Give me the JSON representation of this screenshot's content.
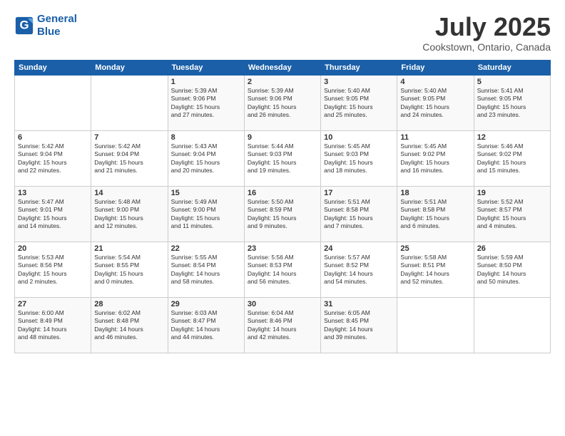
{
  "logo": {
    "line1": "General",
    "line2": "Blue"
  },
  "title": "July 2025",
  "location": "Cookstown, Ontario, Canada",
  "weekdays": [
    "Sunday",
    "Monday",
    "Tuesday",
    "Wednesday",
    "Thursday",
    "Friday",
    "Saturday"
  ],
  "weeks": [
    [
      {
        "day": "",
        "content": ""
      },
      {
        "day": "",
        "content": ""
      },
      {
        "day": "1",
        "content": "Sunrise: 5:39 AM\nSunset: 9:06 PM\nDaylight: 15 hours\nand 27 minutes."
      },
      {
        "day": "2",
        "content": "Sunrise: 5:39 AM\nSunset: 9:06 PM\nDaylight: 15 hours\nand 26 minutes."
      },
      {
        "day": "3",
        "content": "Sunrise: 5:40 AM\nSunset: 9:05 PM\nDaylight: 15 hours\nand 25 minutes."
      },
      {
        "day": "4",
        "content": "Sunrise: 5:40 AM\nSunset: 9:05 PM\nDaylight: 15 hours\nand 24 minutes."
      },
      {
        "day": "5",
        "content": "Sunrise: 5:41 AM\nSunset: 9:05 PM\nDaylight: 15 hours\nand 23 minutes."
      }
    ],
    [
      {
        "day": "6",
        "content": "Sunrise: 5:42 AM\nSunset: 9:04 PM\nDaylight: 15 hours\nand 22 minutes."
      },
      {
        "day": "7",
        "content": "Sunrise: 5:42 AM\nSunset: 9:04 PM\nDaylight: 15 hours\nand 21 minutes."
      },
      {
        "day": "8",
        "content": "Sunrise: 5:43 AM\nSunset: 9:04 PM\nDaylight: 15 hours\nand 20 minutes."
      },
      {
        "day": "9",
        "content": "Sunrise: 5:44 AM\nSunset: 9:03 PM\nDaylight: 15 hours\nand 19 minutes."
      },
      {
        "day": "10",
        "content": "Sunrise: 5:45 AM\nSunset: 9:03 PM\nDaylight: 15 hours\nand 18 minutes."
      },
      {
        "day": "11",
        "content": "Sunrise: 5:45 AM\nSunset: 9:02 PM\nDaylight: 15 hours\nand 16 minutes."
      },
      {
        "day": "12",
        "content": "Sunrise: 5:46 AM\nSunset: 9:02 PM\nDaylight: 15 hours\nand 15 minutes."
      }
    ],
    [
      {
        "day": "13",
        "content": "Sunrise: 5:47 AM\nSunset: 9:01 PM\nDaylight: 15 hours\nand 14 minutes."
      },
      {
        "day": "14",
        "content": "Sunrise: 5:48 AM\nSunset: 9:00 PM\nDaylight: 15 hours\nand 12 minutes."
      },
      {
        "day": "15",
        "content": "Sunrise: 5:49 AM\nSunset: 9:00 PM\nDaylight: 15 hours\nand 11 minutes."
      },
      {
        "day": "16",
        "content": "Sunrise: 5:50 AM\nSunset: 8:59 PM\nDaylight: 15 hours\nand 9 minutes."
      },
      {
        "day": "17",
        "content": "Sunrise: 5:51 AM\nSunset: 8:58 PM\nDaylight: 15 hours\nand 7 minutes."
      },
      {
        "day": "18",
        "content": "Sunrise: 5:51 AM\nSunset: 8:58 PM\nDaylight: 15 hours\nand 6 minutes."
      },
      {
        "day": "19",
        "content": "Sunrise: 5:52 AM\nSunset: 8:57 PM\nDaylight: 15 hours\nand 4 minutes."
      }
    ],
    [
      {
        "day": "20",
        "content": "Sunrise: 5:53 AM\nSunset: 8:56 PM\nDaylight: 15 hours\nand 2 minutes."
      },
      {
        "day": "21",
        "content": "Sunrise: 5:54 AM\nSunset: 8:55 PM\nDaylight: 15 hours\nand 0 minutes."
      },
      {
        "day": "22",
        "content": "Sunrise: 5:55 AM\nSunset: 8:54 PM\nDaylight: 14 hours\nand 58 minutes."
      },
      {
        "day": "23",
        "content": "Sunrise: 5:56 AM\nSunset: 8:53 PM\nDaylight: 14 hours\nand 56 minutes."
      },
      {
        "day": "24",
        "content": "Sunrise: 5:57 AM\nSunset: 8:52 PM\nDaylight: 14 hours\nand 54 minutes."
      },
      {
        "day": "25",
        "content": "Sunrise: 5:58 AM\nSunset: 8:51 PM\nDaylight: 14 hours\nand 52 minutes."
      },
      {
        "day": "26",
        "content": "Sunrise: 5:59 AM\nSunset: 8:50 PM\nDaylight: 14 hours\nand 50 minutes."
      }
    ],
    [
      {
        "day": "27",
        "content": "Sunrise: 6:00 AM\nSunset: 8:49 PM\nDaylight: 14 hours\nand 48 minutes."
      },
      {
        "day": "28",
        "content": "Sunrise: 6:02 AM\nSunset: 8:48 PM\nDaylight: 14 hours\nand 46 minutes."
      },
      {
        "day": "29",
        "content": "Sunrise: 6:03 AM\nSunset: 8:47 PM\nDaylight: 14 hours\nand 44 minutes."
      },
      {
        "day": "30",
        "content": "Sunrise: 6:04 AM\nSunset: 8:46 PM\nDaylight: 14 hours\nand 42 minutes."
      },
      {
        "day": "31",
        "content": "Sunrise: 6:05 AM\nSunset: 8:45 PM\nDaylight: 14 hours\nand 39 minutes."
      },
      {
        "day": "",
        "content": ""
      },
      {
        "day": "",
        "content": ""
      }
    ]
  ]
}
